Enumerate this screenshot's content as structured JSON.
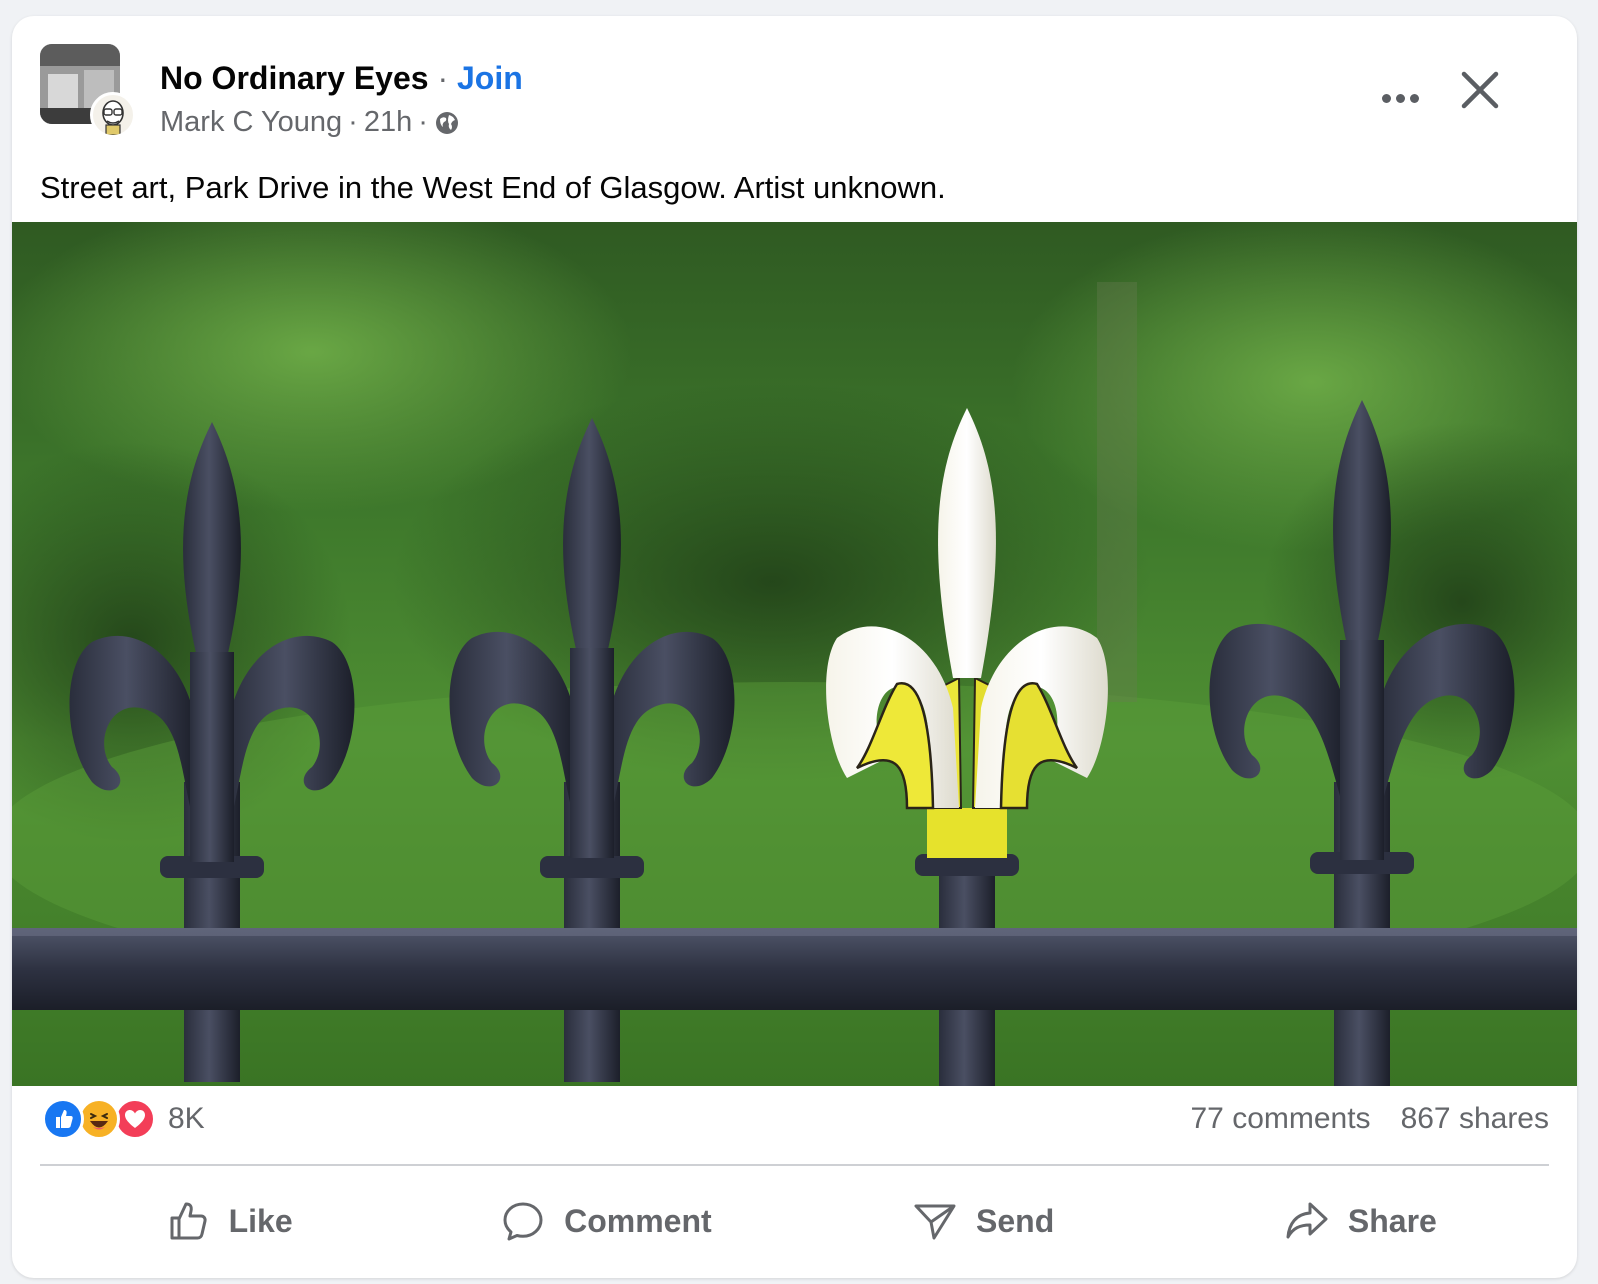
{
  "post": {
    "group_name": "No Ordinary Eyes",
    "separator": "·",
    "join_label": "Join",
    "author": "Mark C Young",
    "time": "21h",
    "privacy_icon": "globe-icon",
    "caption": "Street art, Park Drive in the West End of Glasgow. Artist unknown.",
    "photo_subject": "fence-finials-banana-street-art"
  },
  "reactions": {
    "icons": [
      "like-reaction-icon",
      "haha-reaction-icon",
      "love-reaction-icon"
    ],
    "count": "8K"
  },
  "stats": {
    "comments": "77 comments",
    "shares": "867 shares"
  },
  "actions": {
    "like": "Like",
    "comment": "Comment",
    "send": "Send",
    "share": "Share"
  },
  "colors": {
    "accent": "#1b74e4",
    "secondary_text": "#65676b",
    "like_blue": "#1877f2",
    "love_red": "#f33e58",
    "haha_yellow": "#f7b125"
  }
}
